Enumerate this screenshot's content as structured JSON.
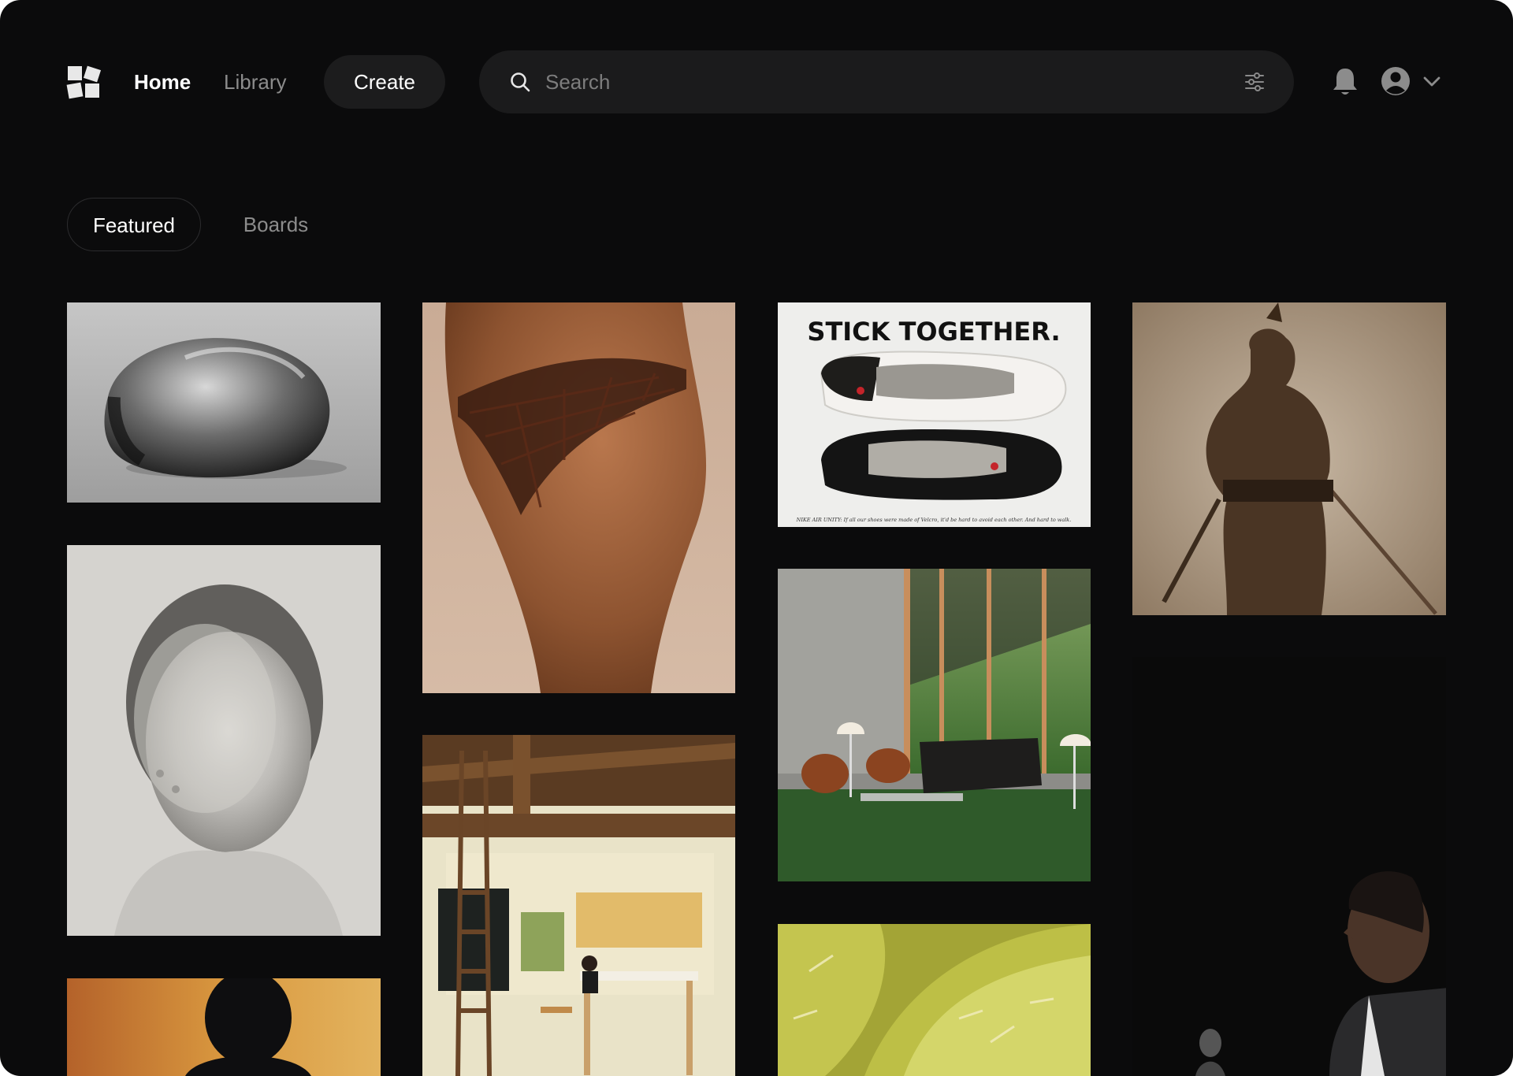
{
  "header": {
    "logo_icon": "logo-icon",
    "nav": [
      {
        "label": "Home",
        "active": true
      },
      {
        "label": "Library",
        "active": false
      }
    ],
    "create_label": "Create",
    "search": {
      "placeholder": "Search",
      "value": ""
    },
    "icons": [
      "search-icon",
      "filter-icon",
      "bell-icon",
      "avatar-icon",
      "chevron-down-icon"
    ]
  },
  "tabs": [
    {
      "label": "Featured",
      "active": true
    },
    {
      "label": "Boards",
      "active": false
    }
  ],
  "feed": {
    "poster": {
      "headline": "STICK TOGETHER.",
      "caption": "NIKE AIR UNITY: If all our shoes were made of Velcro, it'd be hard to avoid each other. And hard to walk."
    }
  },
  "colors": {
    "background": "#0b0b0c",
    "surface": "#1b1b1c",
    "text_primary": "#ffffff",
    "text_muted": "#8c8c8c"
  }
}
